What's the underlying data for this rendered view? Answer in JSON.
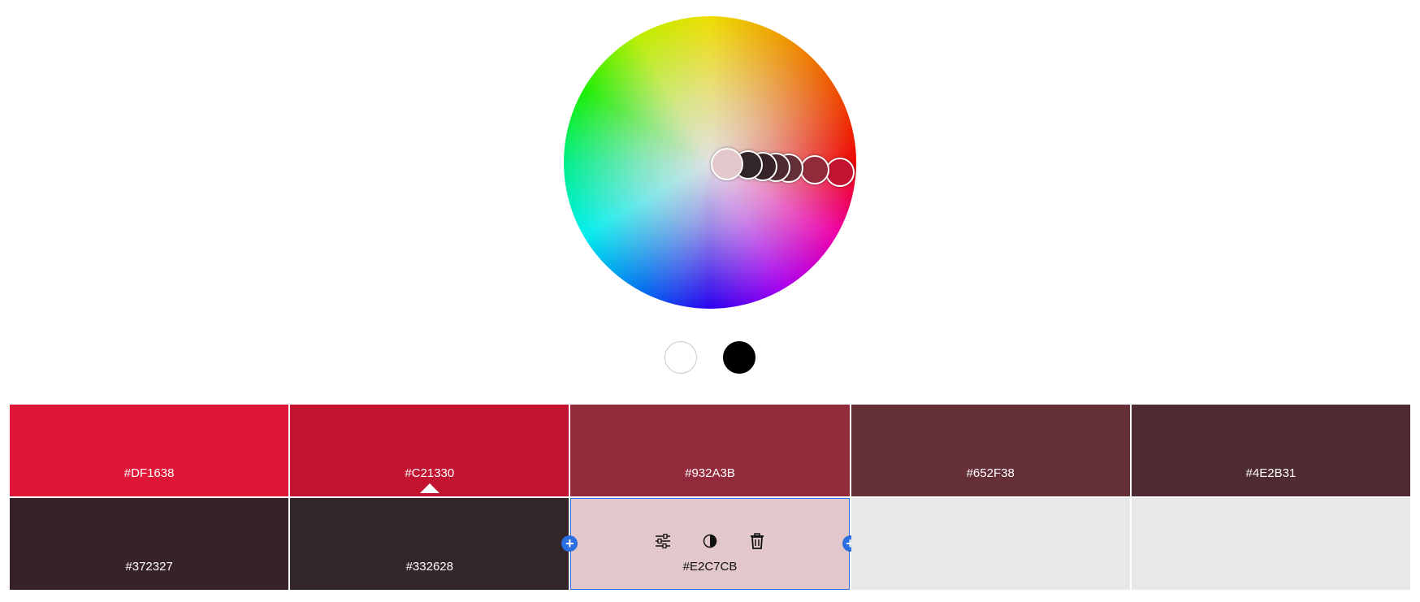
{
  "wheel": {
    "handles": [
      {
        "name": "handle-6",
        "color": "#C21330"
      },
      {
        "name": "handle-5",
        "color": "#932A3B"
      },
      {
        "name": "handle-4",
        "color": "#652F38"
      },
      {
        "name": "handle-3",
        "color": "#4E2B31"
      },
      {
        "name": "handle-2",
        "color": "#372327"
      },
      {
        "name": "handle-1",
        "color": "#332628"
      },
      {
        "name": "base-handle",
        "color": "#E2C7CB"
      }
    ]
  },
  "brightness": {
    "light": "#FFFFFF",
    "dark": "#000000"
  },
  "swatches": [
    {
      "hex": "#DF1638",
      "color": "#DF1638"
    },
    {
      "hex": "#C21330",
      "color": "#C21330"
    },
    {
      "hex": "#932A3B",
      "color": "#932A3B"
    },
    {
      "hex": "#652F38",
      "color": "#652F38"
    },
    {
      "hex": "#4E2B31",
      "color": "#4E2B31"
    },
    {
      "hex": "#372327",
      "color": "#372327"
    },
    {
      "hex": "#332628",
      "color": "#332628"
    },
    {
      "hex": "#E2C7CB",
      "color": "#E2C7CB"
    },
    {
      "hex": "",
      "color": "#E8E8E8"
    },
    {
      "hex": "",
      "color": "#E8E8E8"
    }
  ],
  "selected_index": 7,
  "base_marker_index": 1,
  "icons": {
    "adjust": "sliders-icon",
    "contrast": "contrast-icon",
    "delete": "trash-icon",
    "add": "plus-icon"
  },
  "accent": "#2C6FE0"
}
